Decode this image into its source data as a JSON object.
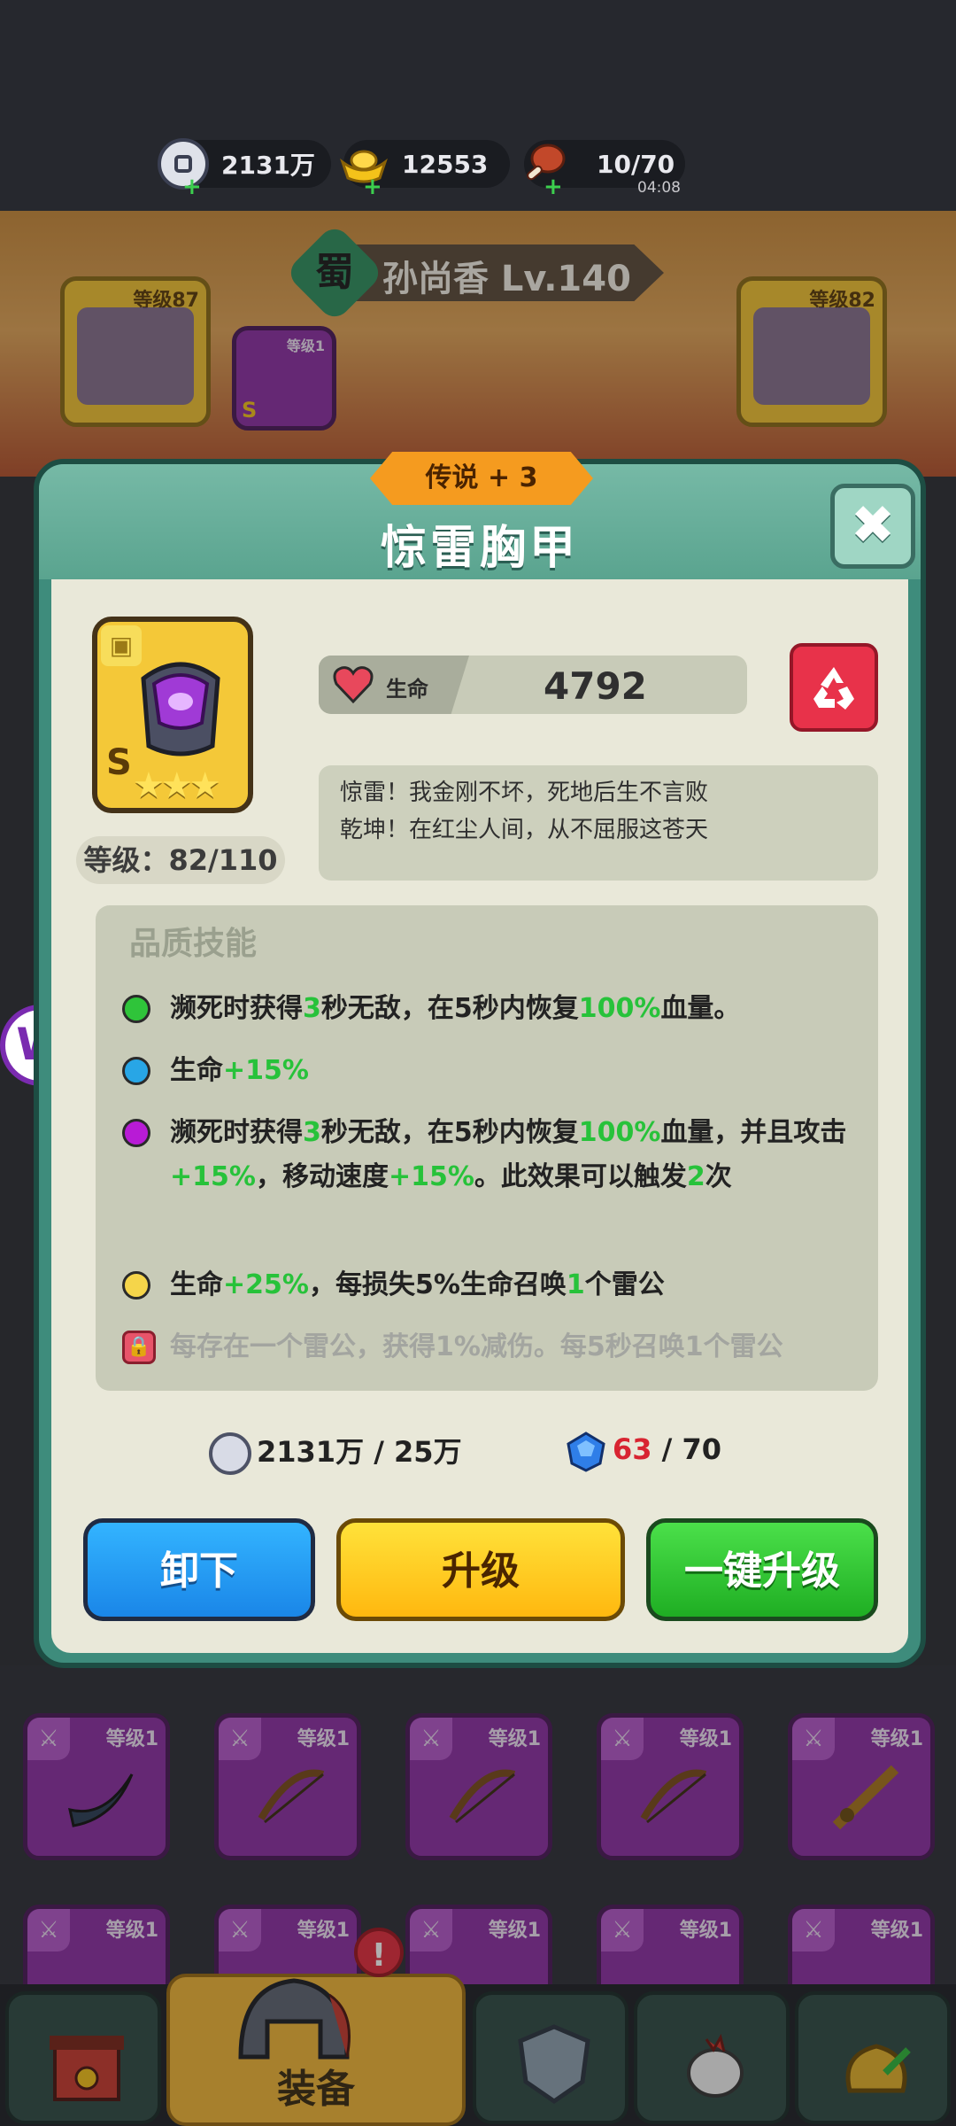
{
  "status_bar": {
    "coins": "2131万",
    "gold": "12553",
    "stamina": "10/70",
    "stamina_timer": "04:08",
    "plus": "+"
  },
  "hero": {
    "kingdom": "蜀",
    "name": "孙尚香 Lv.140",
    "left_slot_level": "等级87",
    "right_slot_level": "等级82",
    "small_slot_level": "等级1",
    "small_slot_grade": "S"
  },
  "modal": {
    "rarity": "传说 + 3",
    "title": "惊雷胸甲",
    "close": "✖",
    "item": {
      "grade": "S",
      "stars": "★★★",
      "level": "等级：82/110"
    },
    "stat": {
      "label": "生命",
      "value": "4792"
    },
    "description": [
      "惊雷！我金刚不坏，死地后生不言败",
      "乾坤！在红尘人间，从不屈服这苍天"
    ],
    "skills_title": "品质技能",
    "skills": [
      {
        "color": "#2fc43a",
        "parts": [
          "濒死时获得",
          "3",
          "秒无敌，在5秒内恢复",
          "100%",
          "血量。"
        ]
      },
      {
        "color": "#28a6e6",
        "parts": [
          "生命",
          "+15%"
        ]
      },
      {
        "color": "#b81bd6",
        "parts": [
          "濒死时获得",
          "3",
          "秒无敌，在5秒内恢复",
          "100%",
          "血量，并且攻击",
          "+15%",
          "，移动速度",
          "+15%",
          "。此效果可以触发",
          "2",
          "次"
        ]
      },
      {
        "color": "#f5d54a",
        "parts": [
          "生命",
          "+25%",
          "，每损失5%生命召唤",
          "1",
          "个雷公"
        ]
      }
    ],
    "locked_skill": "每存在一个雷公，获得1%减伤。每5秒召唤1个雷公",
    "cost": {
      "coins": "2131万 / 25万",
      "gems_have": "63",
      "gems_need": " / 70"
    },
    "buttons": {
      "unequip": "卸下",
      "upgrade": "升级",
      "one_click": "一键升级"
    }
  },
  "grid": {
    "item_level": "等级1"
  },
  "nav": {
    "active_label": "装备",
    "alert": "!"
  },
  "side_badge": "W",
  "colors": {
    "accent_green": "#27c23a",
    "modal_teal": "#3e8c7c",
    "danger_red": "#e8324a"
  }
}
